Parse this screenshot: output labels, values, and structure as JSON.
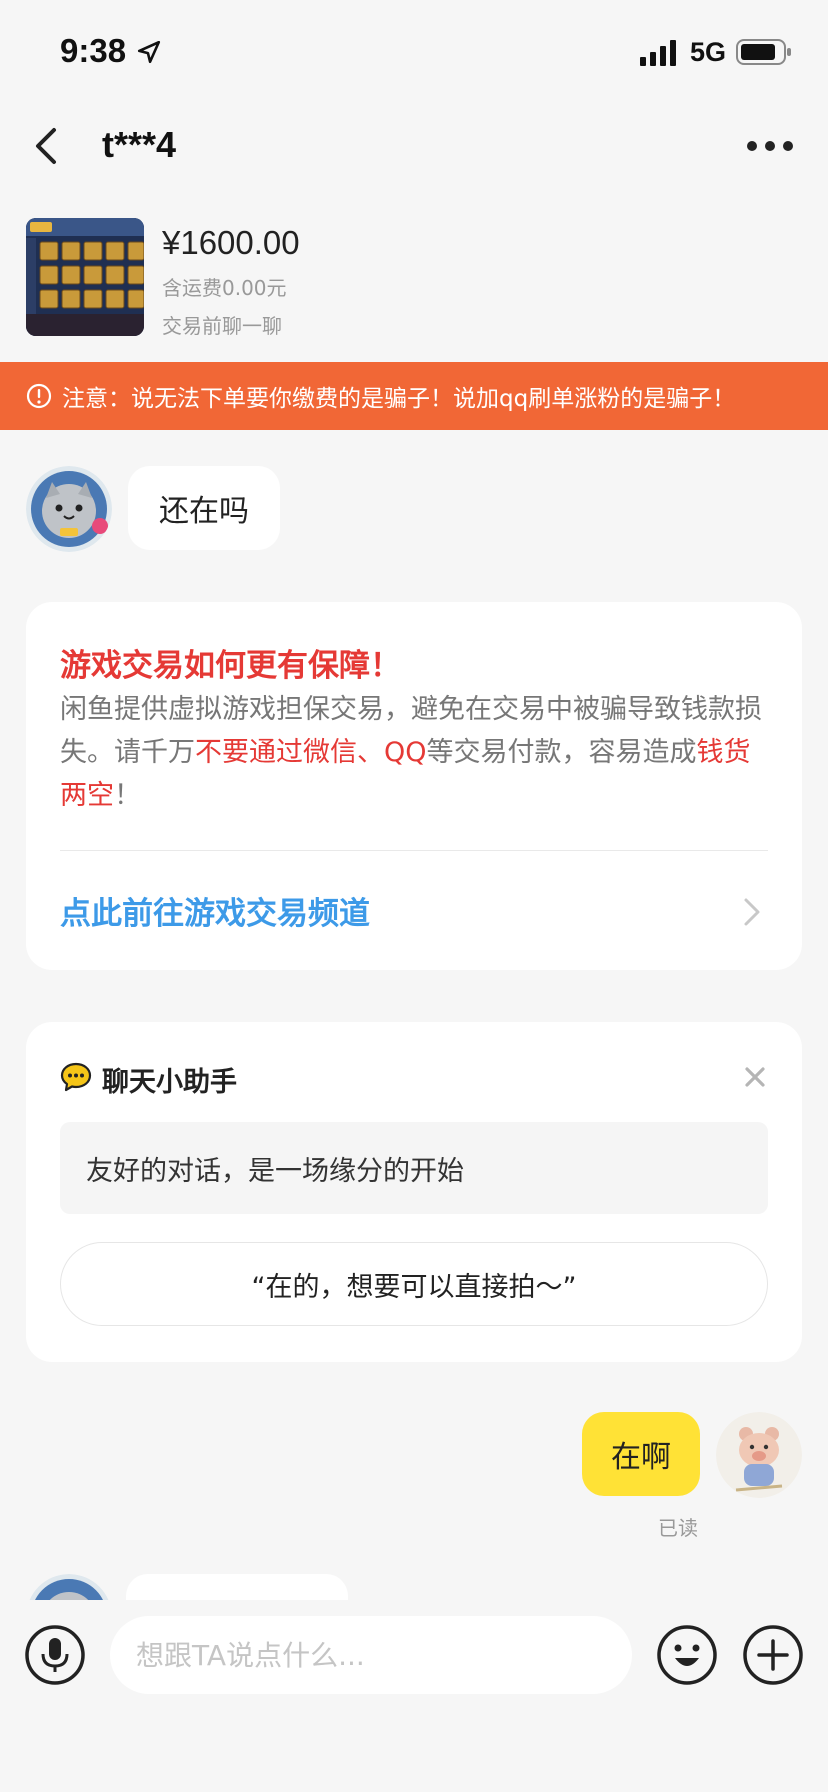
{
  "status_bar": {
    "time": "9:38",
    "network": "5G",
    "icons": [
      "location-arrow-icon",
      "signal-icon",
      "battery-icon"
    ]
  },
  "nav": {
    "title": "t***4",
    "icons": [
      "back-chevron-icon",
      "more-dots-icon"
    ]
  },
  "product": {
    "price": "¥1600.00",
    "shipping": "含运费0.00元",
    "hint": "交易前聊一聊"
  },
  "warning": {
    "text": "注意：说无法下单要你缴费的是骗子！说加qq刷单涨粉的是骗子！",
    "color": "#f16736",
    "icon": "alert-circle-icon"
  },
  "messages": {
    "incoming_1": "还在吗",
    "outgoing_1": "在啊",
    "outgoing_1_status": "已读"
  },
  "game_card": {
    "title": "游戏交易如何更有保障！",
    "body_part1": "闲鱼提供虚拟游戏担保交易，避免在交易中被骗导致钱款损失。请千万",
    "body_red1": "不要通过微信、QQ",
    "body_part2": "等交易付款，容易造成",
    "body_red2": "钱货两空",
    "body_part3": "！",
    "link": "点此前往游戏交易频道",
    "accent_color": "#e53935",
    "link_color": "#3d9ae8"
  },
  "helper_card": {
    "title": "聊天小助手",
    "tip": "友好的对话，是一场缘分的开始",
    "suggestion": "“在的，想要可以直接拍～”",
    "icons": [
      "chat-bubble-icon",
      "close-icon"
    ]
  },
  "input_bar": {
    "placeholder": "想跟TA说点什么...",
    "icons": [
      "microphone-icon",
      "emoji-icon",
      "plus-icon"
    ]
  },
  "colors": {
    "background": "#f6f6f6",
    "outgoing_bubble": "#ffe236"
  }
}
